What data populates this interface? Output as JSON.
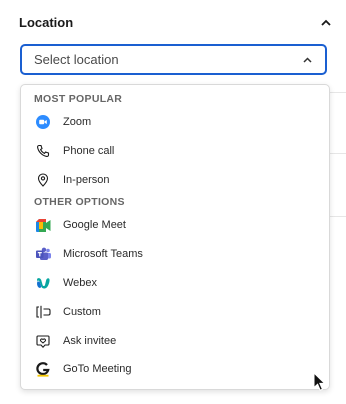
{
  "section": {
    "title": "Location"
  },
  "select": {
    "placeholder": "Select location"
  },
  "dropdown": {
    "groups": [
      {
        "header": "MOST POPULAR",
        "options": [
          {
            "label": "Zoom",
            "icon": "zoom-icon"
          },
          {
            "label": "Phone call",
            "icon": "phone-icon"
          },
          {
            "label": "In-person",
            "icon": "map-pin-icon"
          }
        ]
      },
      {
        "header": "OTHER OPTIONS",
        "options": [
          {
            "label": "Google Meet",
            "icon": "google-meet-icon"
          },
          {
            "label": "Microsoft Teams",
            "icon": "microsoft-teams-icon"
          },
          {
            "label": "Webex",
            "icon": "webex-icon"
          },
          {
            "label": "Custom",
            "icon": "custom-location-icon"
          },
          {
            "label": "Ask invitee",
            "icon": "ask-invitee-icon"
          },
          {
            "label": "GoTo Meeting",
            "icon": "goto-meeting-icon"
          }
        ]
      }
    ]
  },
  "colors": {
    "focus_border": "#1a5fd1",
    "zoom_blue": "#2d8cff",
    "teams_purple": "#5b5fc7",
    "webex_teal": "#07a6a0",
    "goto_yellow": "#f6c800"
  }
}
